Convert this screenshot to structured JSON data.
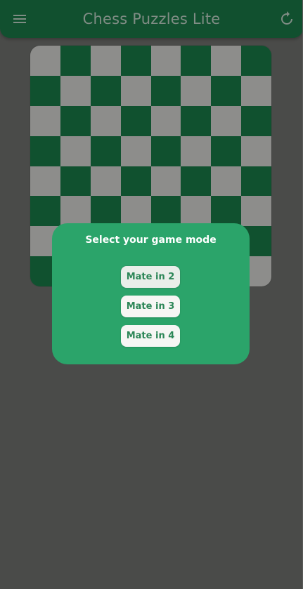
{
  "app_bar": {
    "title": "Chess Puzzles Lite",
    "menu_icon": "hamburger-menu-icon",
    "reload_icon": "reload-icon",
    "color": "#11502f"
  },
  "board": {
    "light_color": "#8d8d8b",
    "dark_color": "#10512f",
    "size": 8
  },
  "mode_dialog": {
    "title": "Select your game mode",
    "background": "#2ba46a",
    "options": [
      {
        "label": "Mate in 2",
        "selected": true
      },
      {
        "label": "Mate in 3",
        "selected": false
      },
      {
        "label": "Mate in 4",
        "selected": false
      }
    ]
  }
}
